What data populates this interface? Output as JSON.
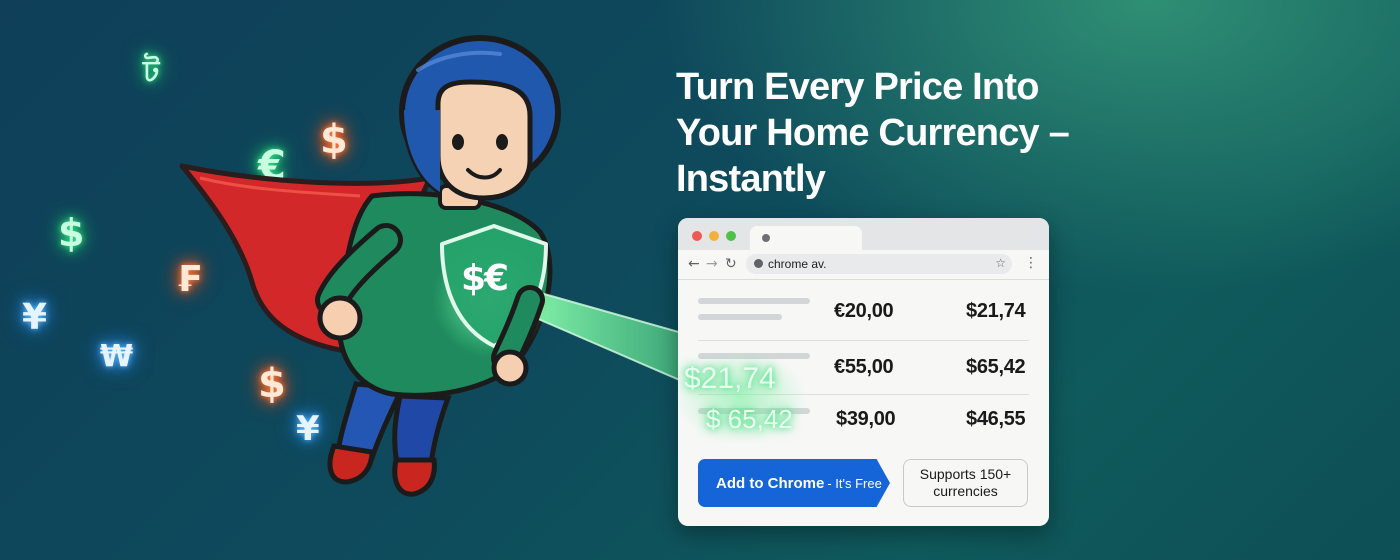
{
  "headline": {
    "line1": "Turn Every Price Into",
    "line2": "Your Home Currency –",
    "line3": "Instantly"
  },
  "hero": {
    "chest_symbol": "$€"
  },
  "floating_symbols": [
    {
      "glyph": "ট",
      "color": "green"
    },
    {
      "glyph": "€",
      "color": "green"
    },
    {
      "glyph": "$",
      "color": "orange"
    },
    {
      "glyph": "$",
      "color": "green"
    },
    {
      "glyph": "₣",
      "color": "orange"
    },
    {
      "glyph": "¥",
      "color": "orange"
    },
    {
      "glyph": "¥",
      "color": "blue"
    },
    {
      "glyph": "₩",
      "color": "blue"
    },
    {
      "glyph": "$",
      "color": "orange"
    },
    {
      "glyph": "¥",
      "color": "blue"
    }
  ],
  "browser": {
    "url": "chrome av.",
    "rows": [
      {
        "original": "€20,00",
        "converted": "$21,74"
      },
      {
        "original": "€55,00",
        "converted": "$65,42"
      },
      {
        "original": "$39,00",
        "converted": "$46,55"
      }
    ],
    "cta_label": "Add to Chrome",
    "cta_sub": "- It's Free",
    "supports_line1": "Supports 150+",
    "supports_line2": "currencies"
  },
  "beam_values": [
    "$21,74",
    "$ 65,42"
  ],
  "colors": {
    "accent_blue": "#1565d8",
    "beam_green": "#4de88c",
    "cape_red": "#d62b2b",
    "suit_green": "#1f8a5e",
    "helmet_blue": "#1f56a8"
  }
}
